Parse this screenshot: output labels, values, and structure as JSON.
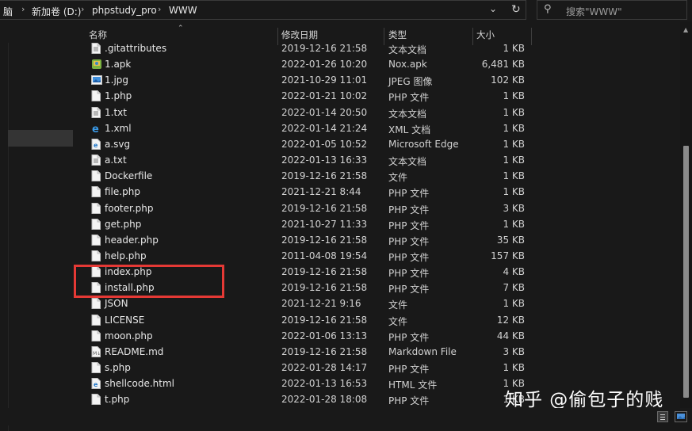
{
  "breadcrumb": {
    "items": [
      "脑",
      "新加卷 (D:)",
      "phpstudy_pro",
      "WWW"
    ],
    "separator": "›"
  },
  "search": {
    "placeholder": "搜索\"WWW\""
  },
  "columns": {
    "name": "名称",
    "date": "修改日期",
    "type": "类型",
    "size": "大小"
  },
  "files": [
    {
      "name": ".gitattributes",
      "date": "2019-12-16 21:58",
      "type": "文本文档",
      "size": "1 KB",
      "icon": "text-file-icon"
    },
    {
      "name": "1.apk",
      "date": "2022-01-26 10:20",
      "type": "Nox.apk",
      "size": "6,481 KB",
      "icon": "apk-file-icon"
    },
    {
      "name": "1.jpg",
      "date": "2021-10-29 11:01",
      "type": "JPEG 图像",
      "size": "102 KB",
      "icon": "image-file-icon"
    },
    {
      "name": "1.php",
      "date": "2022-01-21 10:02",
      "type": "PHP 文件",
      "size": "1 KB",
      "icon": "blank-file-icon"
    },
    {
      "name": "1.txt",
      "date": "2022-01-14 20:50",
      "type": "文本文档",
      "size": "1 KB",
      "icon": "text-file-icon"
    },
    {
      "name": "1.xml",
      "date": "2022-01-14 21:24",
      "type": "XML 文档",
      "size": "1 KB",
      "icon": "ie-file-icon"
    },
    {
      "name": "a.svg",
      "date": "2022-01-05 10:52",
      "type": "Microsoft Edge",
      "size": "1 KB",
      "icon": "edge-file-icon"
    },
    {
      "name": "a.txt",
      "date": "2022-01-13 16:33",
      "type": "文本文档",
      "size": "1 KB",
      "icon": "text-file-icon"
    },
    {
      "name": "Dockerfile",
      "date": "2019-12-16 21:58",
      "type": "文件",
      "size": "1 KB",
      "icon": "blank-file-icon"
    },
    {
      "name": "file.php",
      "date": "2021-12-21 8:44",
      "type": "PHP 文件",
      "size": "1 KB",
      "icon": "blank-file-icon"
    },
    {
      "name": "footer.php",
      "date": "2019-12-16 21:58",
      "type": "PHP 文件",
      "size": "3 KB",
      "icon": "blank-file-icon"
    },
    {
      "name": "get.php",
      "date": "2021-10-27 11:33",
      "type": "PHP 文件",
      "size": "1 KB",
      "icon": "blank-file-icon"
    },
    {
      "name": "header.php",
      "date": "2019-12-16 21:58",
      "type": "PHP 文件",
      "size": "35 KB",
      "icon": "blank-file-icon"
    },
    {
      "name": "help.php",
      "date": "2011-04-08 19:54",
      "type": "PHP 文件",
      "size": "157 KB",
      "icon": "blank-file-icon"
    },
    {
      "name": "index.php",
      "date": "2019-12-16 21:58",
      "type": "PHP 文件",
      "size": "4 KB",
      "icon": "blank-file-icon"
    },
    {
      "name": "install.php",
      "date": "2019-12-16 21:58",
      "type": "PHP 文件",
      "size": "7 KB",
      "icon": "blank-file-icon"
    },
    {
      "name": "JSON",
      "date": "2021-12-21 9:16",
      "type": "文件",
      "size": "1 KB",
      "icon": "blank-file-icon"
    },
    {
      "name": "LICENSE",
      "date": "2019-12-16 21:58",
      "type": "文件",
      "size": "12 KB",
      "icon": "blank-file-icon"
    },
    {
      "name": "moon.php",
      "date": "2022-01-06 13:13",
      "type": "PHP 文件",
      "size": "44 KB",
      "icon": "blank-file-icon"
    },
    {
      "name": "README.md",
      "date": "2019-12-16 21:58",
      "type": "Markdown File",
      "size": "3 KB",
      "icon": "markdown-file-icon"
    },
    {
      "name": "s.php",
      "date": "2022-01-28 14:17",
      "type": "PHP 文件",
      "size": "1 KB",
      "icon": "blank-file-icon"
    },
    {
      "name": "shellcode.html",
      "date": "2022-01-13 16:53",
      "type": "HTML 文件",
      "size": "1 KB",
      "icon": "edge-file-icon"
    },
    {
      "name": "t.php",
      "date": "2022-01-28 18:08",
      "type": "PHP 文件",
      "size": "1 KB",
      "icon": "blank-file-icon"
    }
  ],
  "watermark": "知乎 @偷包子的贱",
  "colors": {
    "background": "#191919",
    "highlight": "#e53935",
    "text": "#e8e8e8"
  }
}
